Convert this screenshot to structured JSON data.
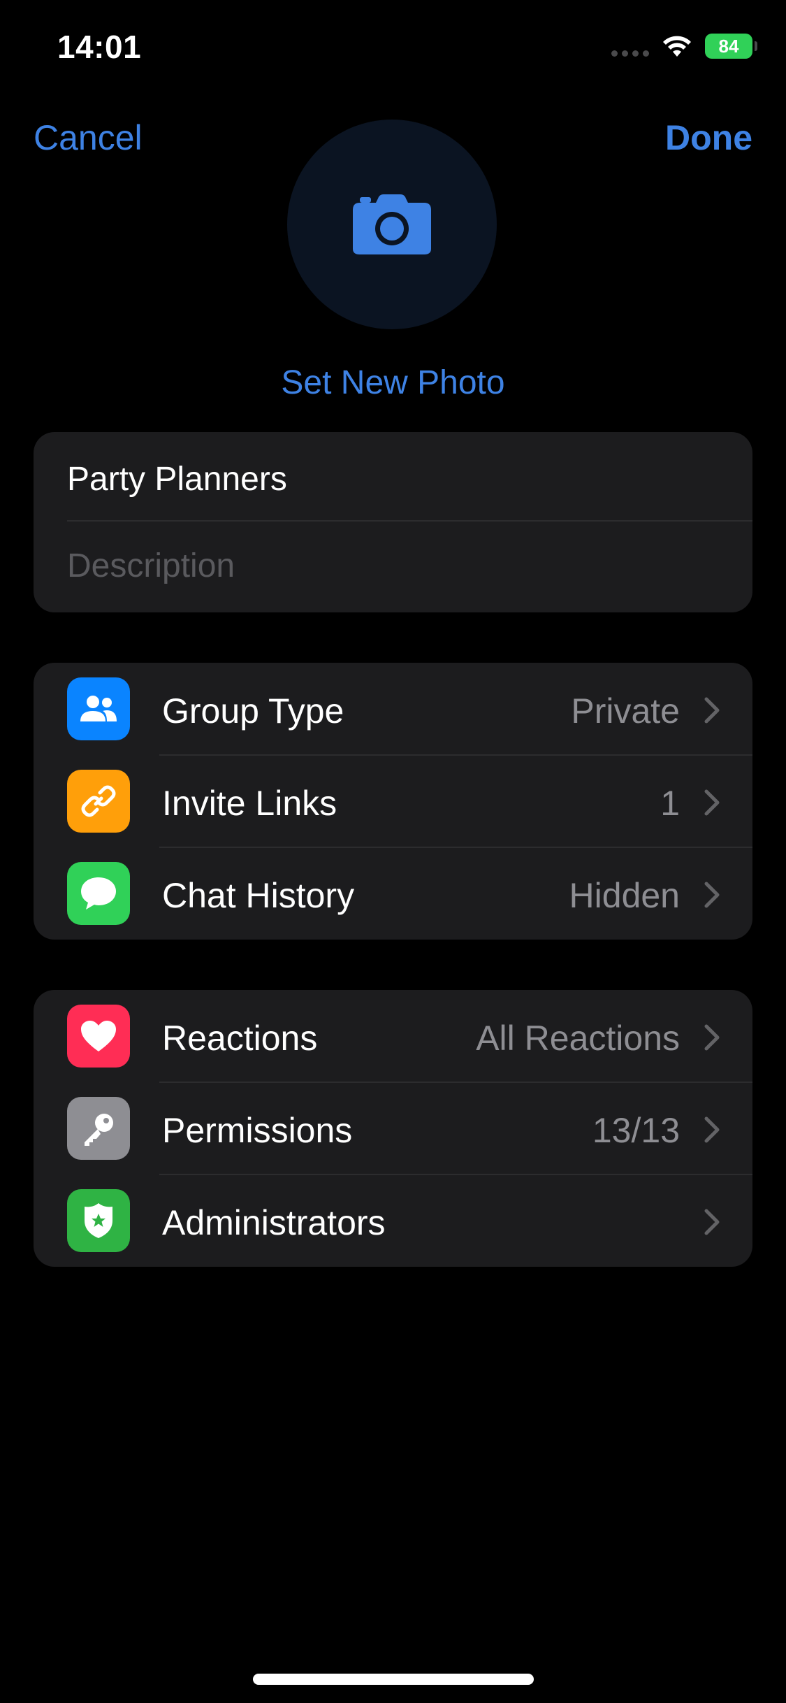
{
  "status_bar": {
    "time": "14:01",
    "battery": "84"
  },
  "nav": {
    "cancel_label": "Cancel",
    "done_label": "Done"
  },
  "photo": {
    "set_photo_label": "Set New Photo",
    "icon": "camera-icon"
  },
  "group_info": {
    "name_value": "Party Planners",
    "description_placeholder": "Description"
  },
  "settings_group_1": [
    {
      "label": "Group Type",
      "value": "Private",
      "icon": "group-people-icon",
      "icon_color": "#0a84ff"
    },
    {
      "label": "Invite Links",
      "value": "1",
      "icon": "link-icon",
      "icon_color": "#ff9f0a"
    },
    {
      "label": "Chat History",
      "value": "Hidden",
      "icon": "chat-bubble-icon",
      "icon_color": "#30d158"
    }
  ],
  "settings_group_2": [
    {
      "label": "Reactions",
      "value": "All Reactions",
      "icon": "heart-icon",
      "icon_color": "#ff2d55"
    },
    {
      "label": "Permissions",
      "value": "13/13",
      "icon": "key-icon",
      "icon_color": "#8e8e93"
    },
    {
      "label": "Administrators",
      "value": "",
      "icon": "admin-badge-icon",
      "icon_color": "#2fb344"
    }
  ],
  "colors": {
    "accent": "#3e82e4",
    "background": "#000000",
    "cell_background": "#1c1c1e",
    "secondary_text": "#8e8e93"
  }
}
